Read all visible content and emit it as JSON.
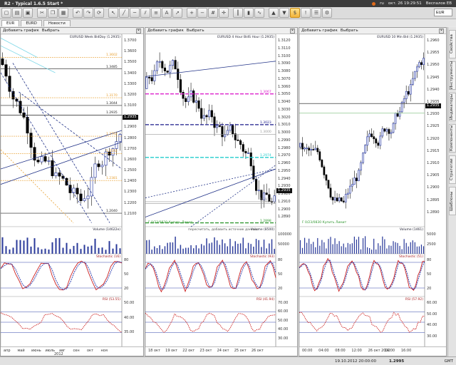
{
  "titlebar": {
    "title": "R2 - Typical 1.6.5 Start *",
    "lang": "ru",
    "clock": "окт. 26 19:29:51",
    "user": "Веспалов ЕВ"
  },
  "toolbar": {
    "symbol": "EUR"
  },
  "tabs": [
    "EUR",
    "EURD",
    "Новости"
  ],
  "panels": [
    {
      "toolbar": {
        "add_chart": "Добавить график",
        "select": "Выбрать"
      },
      "title": "EURUSD Week BidDay (1.2935)",
      "price_ticks": [
        "1.3700",
        "1.3600",
        "1.3500",
        "1.3400",
        "1.3300",
        "1.3200",
        "1.3100",
        "1.3000",
        "1.2900",
        "1.2800",
        "1.2700",
        "1.2600",
        "1.2500",
        "1.2400",
        "1.2300",
        "1.2200",
        "1.2100"
      ],
      "price_tag": "1.2935",
      "levels": [
        "1.3602",
        "1.3485",
        "1.3170",
        "1.3044",
        "1.2935",
        "1.2762",
        "1.2592",
        "1.2381",
        "1.2040"
      ],
      "volume_label": "Volume (14622e)",
      "stoch_label": "Stochastic (16)",
      "rsi_label": "RSI (53.55)",
      "stoch_ticks": [
        "80",
        "50",
        "20"
      ],
      "rsi_ticks": [
        "50.00",
        "40.00",
        "35.00"
      ],
      "x_labels": [
        "апр",
        "май",
        "июнь",
        "июль",
        "авг",
        "сен",
        "окт",
        "ноя"
      ],
      "x_year": "2012"
    },
    {
      "toolbar": {
        "add_chart": "Добавить график",
        "select": "Выбрать"
      },
      "title": "EURUSD 4 Hour BidS Hour (1.2935)",
      "price_ticks": [
        "1.3120",
        "1.3110",
        "1.3100",
        "1.3090",
        "1.3080",
        "1.3070",
        "1.3060",
        "1.3050",
        "1.3040",
        "1.3030",
        "1.3020",
        "1.3010",
        "1.3000",
        "1.2990",
        "1.2980",
        "1.2970",
        "1.2960",
        "1.2950",
        "1.2940",
        "1.2930",
        "1.2920",
        "1.2910",
        "1.2900",
        "1.2890"
      ],
      "price_tag": "1.2935",
      "levels": [
        "1.3067",
        "1.3023",
        "1.3000",
        "1.2974",
        "1.2917",
        "1.2914",
        "1.2898"
      ],
      "bottom_note": "F 0/23/0830 Купить Лимит",
      "volume_label": "Volume (8500)",
      "volume_note": "пересчитать, добавить источник данных",
      "volume_ticks": [
        "100000",
        "50000"
      ],
      "stoch_label": "Stochastic (93)",
      "rsi_label": "RSI (41.94)",
      "stoch_ticks": [
        "80",
        "50",
        "20"
      ],
      "rsi_ticks": [
        "70.00",
        "60.00",
        "50.00",
        "40.00",
        "30.00"
      ],
      "x_labels": [
        "18 окт",
        "19 окт",
        "22 окт",
        "23 окт",
        "24 окт",
        "25 окт",
        "26 окт"
      ]
    },
    {
      "toolbar": {
        "add_chart": "Добавить график",
        "select": "Выбрать"
      },
      "title": "EURUSD 10 Min Bid (1.2935)",
      "price_ticks": [
        "1.2960",
        "1.2955",
        "1.2950",
        "1.2945",
        "1.2940",
        "1.2935",
        "1.2930",
        "1.2925",
        "1.2920",
        "1.2915",
        "1.2910",
        "1.2905",
        "1.2900",
        "1.2895",
        "1.2890"
      ],
      "price_tag": "1.2935",
      "bottom_note": "F 0/23/0830 Купить Лимит",
      "volume_label": "Volume (1461)",
      "volume_ticks": [
        "5000",
        "2500"
      ],
      "stoch_label": "Stochastic (51)",
      "rsi_label": "RSI (57.92)",
      "stoch_ticks": [
        "80",
        "50",
        "20"
      ],
      "rsi_ticks": [
        "60.00",
        "50.00",
        "40.00",
        "30.00"
      ],
      "x_labels": [
        "00:00",
        "04:00",
        "08:00",
        "12:00",
        "26 окт 2012",
        "14:00",
        "16:00"
      ]
    }
  ],
  "sidebar": [
    "Свойства",
    "Инструменты",
    "Индикаторы",
    "Компоненты",
    "Стратегии",
    "Шаблоны"
  ],
  "status": {
    "datetime": "19.10.2012 20:00:00",
    "price": "1.2995",
    "tz": "GMT"
  },
  "colors": {
    "accent": "#f2b33a",
    "candle_up": "#3344aa",
    "candle_down": "#000000",
    "magenta": "#dd22cc",
    "navy": "#1a1a8a",
    "cyan": "#22cccc",
    "green": "#339933",
    "rsi": "#cc2222",
    "stoch_k": "#cc2222",
    "stoch_d": "#2233aa"
  }
}
